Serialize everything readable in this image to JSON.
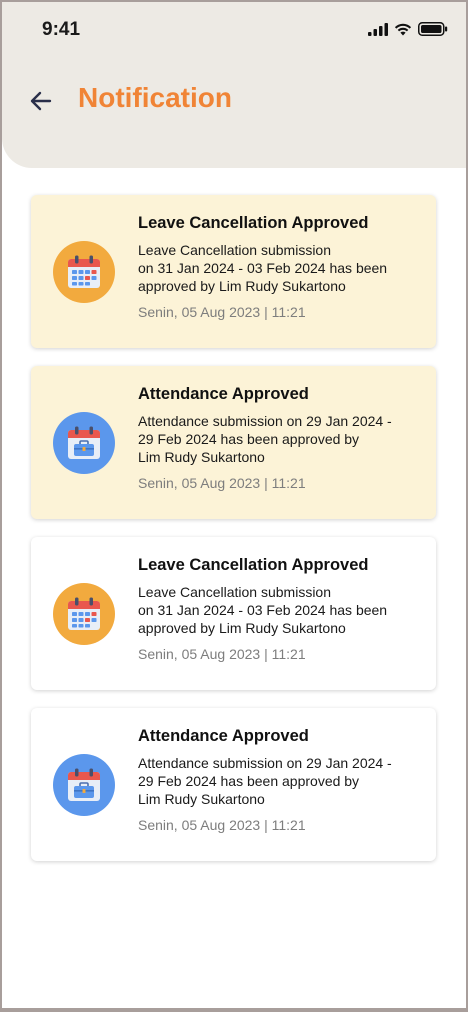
{
  "status_bar": {
    "time": "9:41"
  },
  "header": {
    "title": "Notification"
  },
  "notifications": [
    {
      "title": "Leave Cancellation Approved",
      "body": "Leave Cancellation submission\non 31 Jan 2024 - 03 Feb 2024 has been\napproved by Lim Rudy Sukartono",
      "time": "Senin, 05 Aug 2023 | 11:21",
      "icon": "calendar-icon",
      "read": false
    },
    {
      "title": "Attendance Approved",
      "body": "Attendance submission on 29 Jan 2024 -\n29 Feb 2024 has been approved by\nLim Rudy Sukartono",
      "time": "Senin, 05 Aug 2023 | 11:21",
      "icon": "calendar-briefcase-icon",
      "read": false
    },
    {
      "title": "Leave Cancellation Approved",
      "body": "Leave Cancellation submission\non 31 Jan 2024 - 03 Feb 2024 has been\napproved by Lim Rudy Sukartono",
      "time": "Senin, 05 Aug 2023 | 11:21",
      "icon": "calendar-icon",
      "read": true
    },
    {
      "title": "Attendance Approved",
      "body": "Attendance submission on 29 Jan 2024 -\n29 Feb 2024 has been approved by\nLim Rudy Sukartono",
      "time": "Senin, 05 Aug 2023 | 11:21",
      "icon": "calendar-briefcase-icon",
      "read": true
    }
  ],
  "colors": {
    "accent": "#f08436",
    "unread_bg": "#fcf3d7",
    "leave_icon_bg": "#f2aa3e",
    "attendance_icon_bg": "#5b97ec"
  }
}
